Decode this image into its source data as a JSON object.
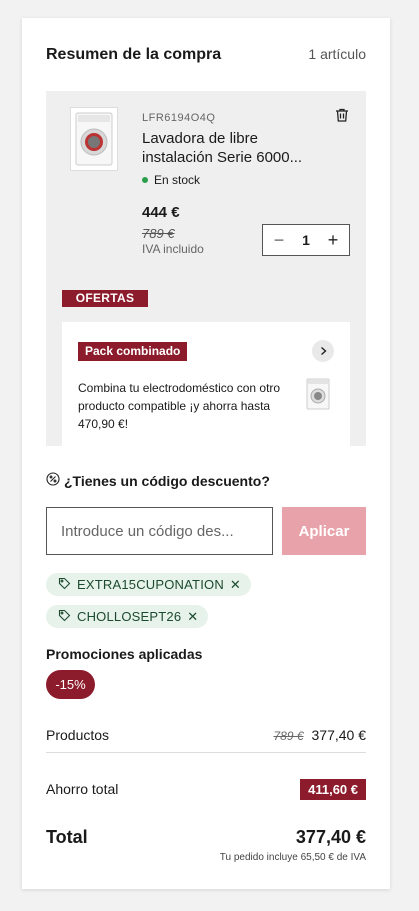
{
  "summary": {
    "title": "Resumen de la compra",
    "item_count": "1 artículo"
  },
  "item": {
    "sku": "LFR6194O4Q",
    "name": "Lavadora de libre instalación Serie 6000...",
    "stock": "En stock",
    "price": "444 €",
    "old_price": "789 €",
    "tax_note": "IVA incluido",
    "quantity": "1",
    "offers_badge": "OFERTAS"
  },
  "pack": {
    "tag": "Pack combinado",
    "text": "Combina tu electrodoméstico con otro producto compatible ¡y ahorra hasta 470,90 €!"
  },
  "discount": {
    "question": "¿Tienes un código descuento?",
    "placeholder": "Introduce un código des...",
    "apply_label": "Aplicar",
    "coupons": [
      "EXTRA15CUPONATION",
      "CHOLLOSEPT26"
    ]
  },
  "promotions": {
    "title": "Promociones aplicadas",
    "badge": "-15%"
  },
  "totals": {
    "products_label": "Productos",
    "products_old": "789 €",
    "products_value": "377,40 €",
    "saving_label": "Ahorro total",
    "saving_value": "411,60 €",
    "total_label": "Total",
    "total_value": "377,40 €",
    "iva_note": "Tu pedido incluye 65,50 € de IVA"
  },
  "colors": {
    "brand": "#8c1c2b",
    "apply_disabled": "#e8a2a9",
    "coupon_bg": "#e6f2ea",
    "stock_dot": "#2a9d4b"
  }
}
